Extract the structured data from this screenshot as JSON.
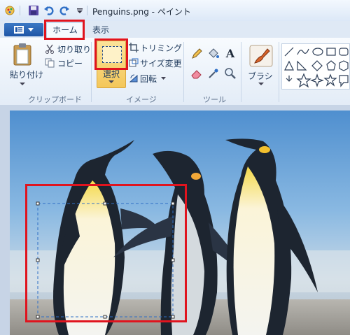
{
  "window": {
    "title": "Penguins.png - ペイント"
  },
  "tabs": {
    "home": "ホーム",
    "view": "表示"
  },
  "clipboard": {
    "paste": "貼り付け",
    "cut": "切り取り",
    "copy": "コピー",
    "group_label": "クリップボード"
  },
  "image": {
    "select": "選択",
    "crop": "トリミング",
    "resize": "サイズ変更",
    "rotate": "回転",
    "group_label": "イメージ"
  },
  "tools": {
    "group_label": "ツール",
    "text_icon_glyph": "A"
  },
  "brushes": {
    "label": "ブラシ"
  },
  "colors": {
    "accent": "#1f56a6",
    "highlight": "#e0141e",
    "select_button": "#f7d36e"
  }
}
